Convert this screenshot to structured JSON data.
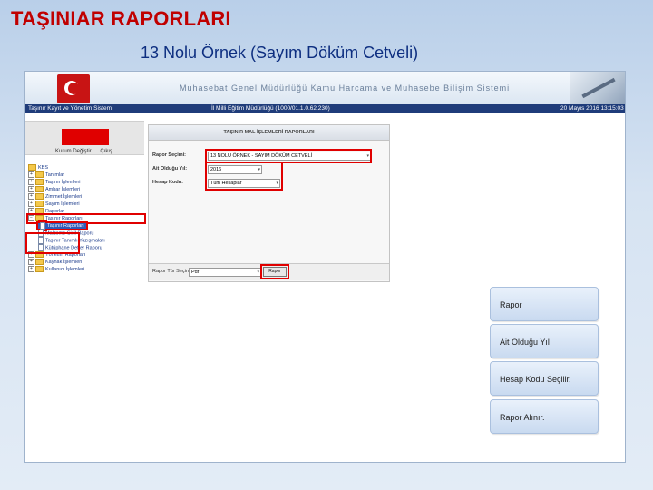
{
  "slide": {
    "title": "TAŞINIAR RAPORLARI",
    "subtitle": "13 Nolu Örnek (Sayım Döküm Cetveli)"
  },
  "app": {
    "banner_title": "Muhasebat Genel Müdürlüğü Kamu Harcama ve Muhasebe Bilişim Sistemi",
    "infobar_left": "Taşınır Kayıt ve Yönetim Sistemi",
    "infobar_mid": "İl Milli Eğitim Müdürlüğü  (1000/01.1.0.62.230)",
    "infobar_right": "20 Mayıs 2016 13:15:03"
  },
  "left_panel": {
    "buttons": [
      "Kurum Değiştir",
      "Çıkış"
    ]
  },
  "tree": [
    {
      "label": "KBS",
      "type": "root"
    },
    {
      "label": "Tanımlar",
      "type": "folder"
    },
    {
      "label": "Taşınır İşlemleri",
      "type": "folder"
    },
    {
      "label": "Ambar İşlemleri",
      "type": "folder"
    },
    {
      "label": "Zimmet İşlemleri",
      "type": "folder"
    },
    {
      "label": "Sayım İşlemleri",
      "type": "folder"
    },
    {
      "label": "Raporlar",
      "type": "folder"
    },
    {
      "label": "Taşınır Raporları",
      "type": "folder",
      "highlight": true
    },
    {
      "label": "Taşınır Raporları",
      "type": "doc",
      "child": true,
      "selected": true
    },
    {
      "label": "Malzeme Sicil Raporu",
      "type": "doc",
      "child": true
    },
    {
      "label": "Taşınır Tanımlı Yazışmaları",
      "type": "doc",
      "child": true
    },
    {
      "label": "Kütüphane Defter Raporu",
      "type": "doc",
      "child": true
    },
    {
      "label": "Yönetim Raporları",
      "type": "folder"
    },
    {
      "label": "Kaynak İşlemleri",
      "type": "folder"
    },
    {
      "label": "Kullanıcı İşlemleri",
      "type": "folder"
    }
  ],
  "form": {
    "header": "TAŞINIR MAL İŞLEMLERİ RAPORLARI",
    "rapor_secimi_label": "Rapor Seçimi:",
    "rapor_secimi_value": "13 NOLU ÖRNEK - SAYIM DÖKÜM CETVELİ",
    "ait_yil_label": "Ait Olduğu Yıl:",
    "ait_yil_value": "2016",
    "hesap_kodu_label": "Hesap Kodu:",
    "hesap_kodu_value": "Tüm Hesaplar",
    "rapor_tur_label": "Rapor Tür Seçiniz:",
    "rapor_tur_value": "Pdf",
    "rapor_button": "Rapor"
  },
  "steps": [
    "Rapor",
    "Ait Olduğu Yıl",
    "Hesap Kodu Seçilir.",
    "Rapor Alınır."
  ],
  "colors": {
    "accent_red": "#e00000",
    "title_red": "#c00000",
    "subtitle_blue": "#0d2e80"
  }
}
